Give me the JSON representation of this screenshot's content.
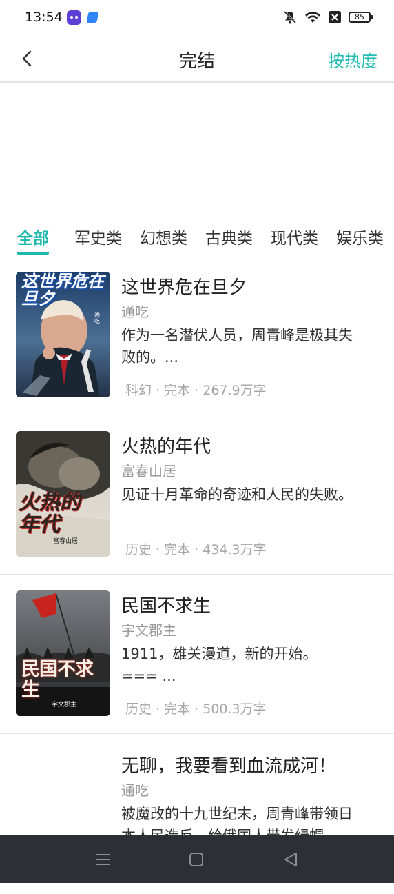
{
  "status_bar": {
    "time": "13:54",
    "battery": "85",
    "icons": [
      "app-icon-purple",
      "app-icon-blue",
      "mute-bell-icon",
      "wifi-icon",
      "close-box-icon",
      "battery-icon"
    ]
  },
  "header": {
    "title": "完结",
    "sort_label": "按热度",
    "accent_color": "#22bcb4"
  },
  "tabs": [
    {
      "label": "全部",
      "active": true
    },
    {
      "label": "军史类",
      "active": false
    },
    {
      "label": "幻想类",
      "active": false
    },
    {
      "label": "古典类",
      "active": false
    },
    {
      "label": "现代类",
      "active": false
    },
    {
      "label": "娱乐类",
      "active": false
    }
  ],
  "books": [
    {
      "title": "这世界危在旦夕",
      "author": "通吃",
      "desc": "作为一名潜伏人员，周青峰是极其失\n败的。...",
      "meta": "科幻 · 完本 · 267.9万字",
      "cover_title": "这世界危在旦夕",
      "cover_author": "通吃"
    },
    {
      "title": "火热的年代",
      "author": "富春山居",
      "desc": "见证十月革命的奇迹和人民的失败。",
      "meta": "历史 · 完本 · 434.3万字",
      "cover_title": "火热的年代",
      "cover_author": "富春山居"
    },
    {
      "title": "民国不求生",
      "author": "宇文郡主",
      "desc": "1911，雄关漫道，新的开始。\n=== ...",
      "meta": "历史 · 完本 · 500.3万字",
      "cover_title": "民国不求生",
      "cover_author": "宇文郡主"
    },
    {
      "title": "无聊，我要看到血流成河！",
      "author": "通吃",
      "desc": "被魔改的十九世纪末，周青峰带领日\n本人民造反，给俄国人带发绿帽。",
      "meta": ""
    }
  ],
  "nav_bar": {
    "buttons": [
      "menu-icon",
      "home-icon",
      "back-triangle-icon"
    ]
  }
}
